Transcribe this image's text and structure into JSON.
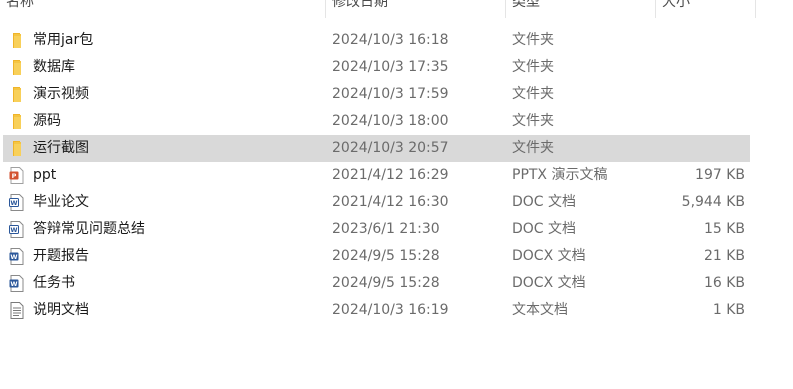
{
  "columns": {
    "name": "名称",
    "date": "修改日期",
    "type": "类型",
    "size": "大小"
  },
  "colors": {
    "folder": "#f4c542",
    "selected_bg": "#d9d9d9",
    "ppt": "#d35230",
    "doc": "#2b579a"
  },
  "files": [
    {
      "name": "常用jar包",
      "date": "2024/10/3 16:18",
      "type": "文件夹",
      "size": "",
      "icon": "folder-icon"
    },
    {
      "name": "数据库",
      "date": "2024/10/3 17:35",
      "type": "文件夹",
      "size": "",
      "icon": "folder-icon"
    },
    {
      "name": "演示视频",
      "date": "2024/10/3 17:59",
      "type": "文件夹",
      "size": "",
      "icon": "folder-icon"
    },
    {
      "name": "源码",
      "date": "2024/10/3 18:00",
      "type": "文件夹",
      "size": "",
      "icon": "folder-icon"
    },
    {
      "name": "运行截图",
      "date": "2024/10/3 20:57",
      "type": "文件夹",
      "size": "",
      "icon": "folder-icon",
      "selected": true
    },
    {
      "name": "ppt",
      "date": "2021/4/12 16:29",
      "type": "PPTX 演示文稿",
      "size": "197 KB",
      "icon": "pptx-icon"
    },
    {
      "name": "毕业论文",
      "date": "2021/4/12 16:30",
      "type": "DOC 文档",
      "size": "5,944 KB",
      "icon": "doc-icon"
    },
    {
      "name": "答辩常见问题总结",
      "date": "2023/6/1 21:30",
      "type": "DOC 文档",
      "size": "15 KB",
      "icon": "doc-icon"
    },
    {
      "name": "开题报告",
      "date": "2024/9/5 15:28",
      "type": "DOCX 文档",
      "size": "21 KB",
      "icon": "docx-icon"
    },
    {
      "name": "任务书",
      "date": "2024/9/5 15:28",
      "type": "DOCX 文档",
      "size": "16 KB",
      "icon": "docx-icon"
    },
    {
      "name": "说明文档",
      "date": "2024/10/3 16:19",
      "type": "文本文档",
      "size": "1 KB",
      "icon": "text-file-icon"
    }
  ]
}
